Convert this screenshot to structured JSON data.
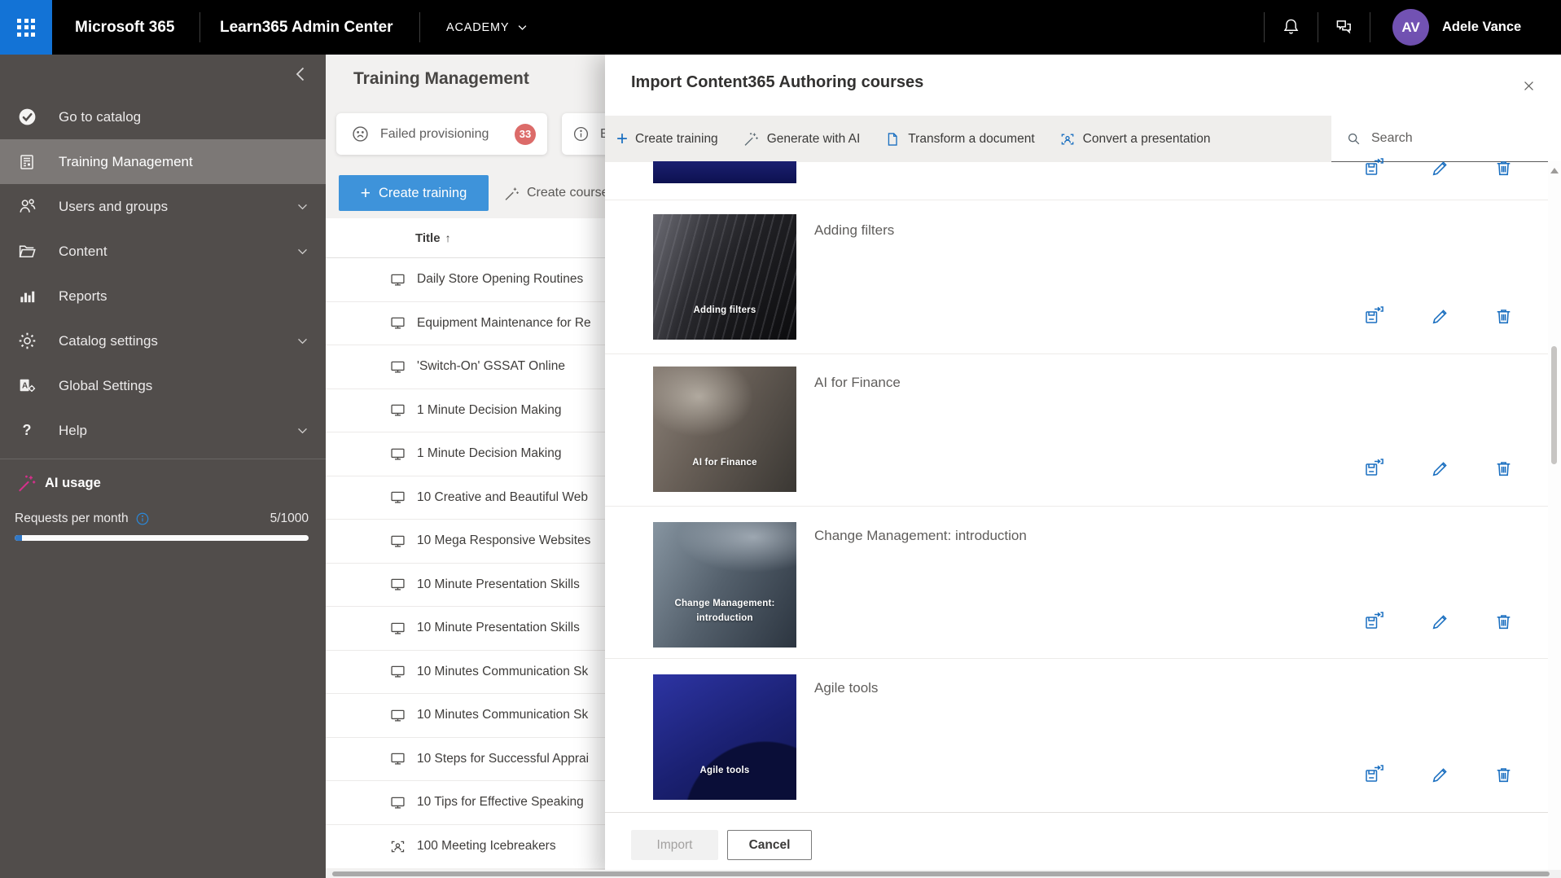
{
  "topbar": {
    "product": "Microsoft 365",
    "app": "Learn365 Admin Center",
    "tenant": "ACADEMY",
    "user": {
      "initials": "AV",
      "name": "Adele Vance"
    }
  },
  "icons": {
    "help_glyph": "?",
    "sort_ascending": "↑",
    "plus": "+"
  },
  "sidebar": {
    "items": [
      {
        "label": "Go to catalog",
        "icon": "catalog-check-icon",
        "selected": false,
        "expandable": false
      },
      {
        "label": "Training Management",
        "icon": "training-document-icon",
        "selected": true,
        "expandable": false
      },
      {
        "label": "Users and groups",
        "icon": "users-icon",
        "selected": false,
        "expandable": true
      },
      {
        "label": "Content",
        "icon": "folder-icon",
        "selected": false,
        "expandable": true
      },
      {
        "label": "Reports",
        "icon": "bar-chart-icon",
        "selected": false,
        "expandable": false
      },
      {
        "label": "Catalog settings",
        "icon": "gear-icon",
        "selected": false,
        "expandable": true
      },
      {
        "label": "Global Settings",
        "icon": "admin-gear-icon",
        "selected": false,
        "expandable": false
      },
      {
        "label": "Help",
        "icon": "question-icon",
        "selected": false,
        "expandable": true
      }
    ],
    "ai_usage": {
      "title": "AI usage",
      "requests_label": "Requests per month",
      "usage_value": "5/1000"
    }
  },
  "main": {
    "page_title": "Training Management",
    "failed_chip": {
      "label": "Failed provisioning",
      "count": "33"
    },
    "info_chip_partial": "E",
    "create_training_button": "Create training",
    "create_course_button": "Create course",
    "table": {
      "title_column": "Title",
      "rows": [
        {
          "title": "Daily Store Opening Routines",
          "icon": "monitor-icon"
        },
        {
          "title": "Equipment Maintenance for Re",
          "icon": "monitor-icon"
        },
        {
          "title": "'Switch-On' GSSAT Online",
          "icon": "monitor-icon"
        },
        {
          "title": "1 Minute Decision Making",
          "icon": "monitor-icon"
        },
        {
          "title": "1 Minute Decision Making",
          "icon": "monitor-icon"
        },
        {
          "title": "10 Creative and Beautiful Web",
          "icon": "monitor-icon"
        },
        {
          "title": "10 Mega Responsive Websites",
          "icon": "monitor-icon"
        },
        {
          "title": "10 Minute Presentation Skills",
          "icon": "monitor-icon"
        },
        {
          "title": "10 Minute Presentation Skills",
          "icon": "monitor-icon"
        },
        {
          "title": "10 Minutes Communication Sk",
          "icon": "monitor-icon"
        },
        {
          "title": "10 Minutes Communication Sk",
          "icon": "monitor-icon"
        },
        {
          "title": "10 Steps for Successful Apprai",
          "icon": "monitor-icon"
        },
        {
          "title": "10 Tips for Effective Speaking",
          "icon": "monitor-icon"
        },
        {
          "title": "100 Meeting Icebreakers",
          "icon": "person-frame-icon"
        }
      ]
    }
  },
  "dialog": {
    "title": "Import Content365 Authoring courses",
    "toolbar": [
      {
        "label": "Create training",
        "icon": "plus-icon"
      },
      {
        "label": "Generate with AI",
        "icon": "wand-icon"
      },
      {
        "label": "Transform a document",
        "icon": "document-icon"
      },
      {
        "label": "Convert a presentation",
        "icon": "person-frame-icon"
      }
    ],
    "search_placeholder": "Search",
    "courses": [
      {
        "title": "",
        "thumb_label": "",
        "variant": "navy-partial"
      },
      {
        "title": "Adding filters",
        "thumb_label": "Adding filters",
        "variant": "skyscraper"
      },
      {
        "title": "AI for Finance",
        "thumb_label": "AI for Finance",
        "variant": "finance"
      },
      {
        "title": "Change Management: introduction",
        "thumb_label": "Change Management: introduction",
        "variant": "meeting"
      },
      {
        "title": "Agile tools",
        "thumb_label": "Agile tools",
        "variant": "agile"
      }
    ],
    "footer": {
      "import_label": "Import",
      "cancel_label": "Cancel",
      "import_disabled": true
    }
  },
  "colors": {
    "topbar_bg": "#000000",
    "waffle_blue": "#1373d6",
    "sidebar_bg": "#514d4b",
    "sidebar_selected": "#7c7876",
    "avatar_purple": "#7252b3",
    "badge_red": "#dc6b69",
    "primary_button_blue": "#3e93da",
    "action_icon_blue": "#1a6fc0",
    "ai_wand_magenta": "#d6308c",
    "info_icon_blue": "#2b88d8"
  }
}
